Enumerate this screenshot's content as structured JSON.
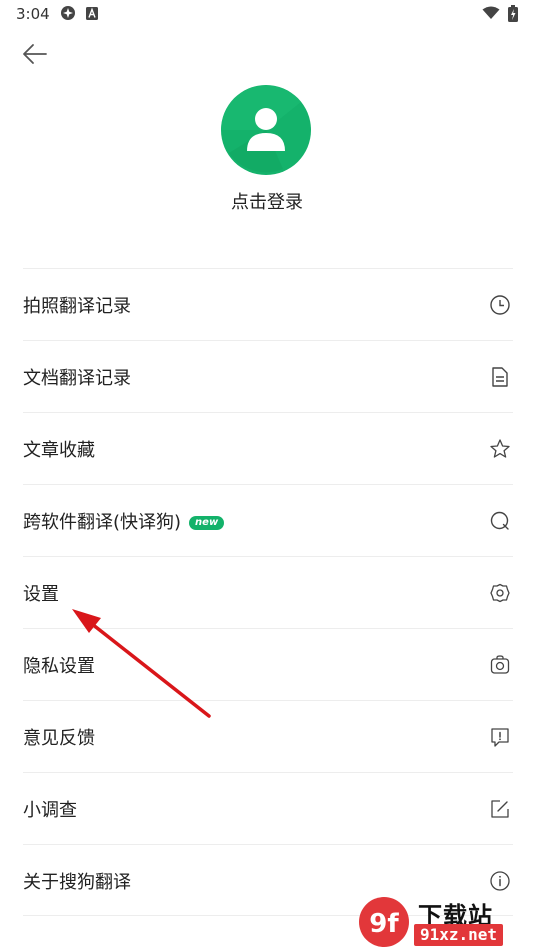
{
  "status_bar": {
    "time": "3:04",
    "icons": [
      "ai-sparkle-icon",
      "app-a-icon",
      "wifi-icon",
      "battery-charging-icon"
    ]
  },
  "header": {
    "back_icon": "arrow-left-icon"
  },
  "profile": {
    "avatar_icon": "user-avatar-icon",
    "avatar_color": "#14b26b",
    "login_label": "点击登录"
  },
  "menu": {
    "items": [
      {
        "label": "拍照翻译记录",
        "icon": "clock-icon"
      },
      {
        "label": "文档翻译记录",
        "icon": "document-icon"
      },
      {
        "label": "文章收藏",
        "icon": "star-icon"
      },
      {
        "label": "跨软件翻译(快译狗)",
        "badge": "new",
        "icon": "search-icon"
      },
      {
        "label": "设置",
        "icon": "settings-gear-icon"
      },
      {
        "label": "隐私设置",
        "icon": "camera-lock-icon"
      },
      {
        "label": "意见反馈",
        "icon": "feedback-icon"
      },
      {
        "label": "小调查",
        "icon": "edit-icon"
      },
      {
        "label": "关于搜狗翻译",
        "icon": "info-icon"
      }
    ]
  },
  "annotation": {
    "arrow_color": "#d9161a"
  },
  "watermark": {
    "logo_text": "9f",
    "title": "下载站",
    "url": "91xz.net",
    "accent": "#e2373a"
  }
}
